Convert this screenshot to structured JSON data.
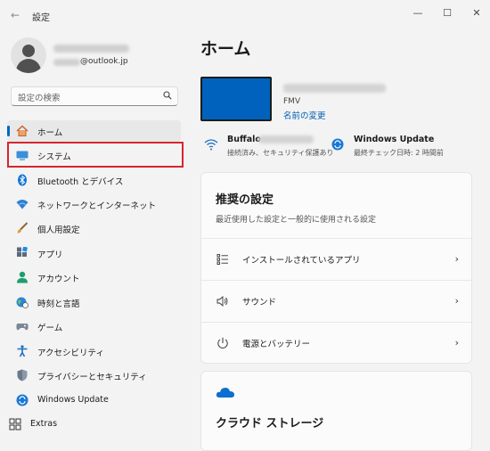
{
  "window": {
    "title": "設定",
    "back": "←",
    "minimize": "—",
    "maximize": "☐",
    "close": "✕"
  },
  "user": {
    "email_domain": "@outlook.jp"
  },
  "search": {
    "placeholder": "設定の検索"
  },
  "sidebar": {
    "items": [
      {
        "label": "ホーム",
        "icon": "home-icon"
      },
      {
        "label": "システム",
        "icon": "system-icon"
      },
      {
        "label": "Bluetooth とデバイス",
        "icon": "bluetooth-icon"
      },
      {
        "label": "ネットワークとインターネット",
        "icon": "network-icon"
      },
      {
        "label": "個人用設定",
        "icon": "brush-icon"
      },
      {
        "label": "アプリ",
        "icon": "apps-icon"
      },
      {
        "label": "アカウント",
        "icon": "account-icon"
      },
      {
        "label": "時刻と言語",
        "icon": "globe-icon"
      },
      {
        "label": "ゲーム",
        "icon": "game-icon"
      },
      {
        "label": "アクセシビリティ",
        "icon": "accessibility-icon"
      },
      {
        "label": "プライバシーとセキュリティ",
        "icon": "shield-icon"
      },
      {
        "label": "Windows Update",
        "icon": "windows-update-icon"
      },
      {
        "label": "Extras",
        "icon": "extras-icon"
      }
    ]
  },
  "main": {
    "title": "ホーム",
    "device": {
      "model": "FMV",
      "rename": "名前の変更"
    },
    "wifi": {
      "name": "Buffalo-",
      "status": "接続済み、セキュリティ保護あり"
    },
    "update": {
      "title": "Windows Update",
      "status": "最終チェック日時: 2 時間前"
    },
    "recommended": {
      "title": "推奨の設定",
      "subtitle": "最近使用した設定と一般的に使用される設定",
      "rows": [
        {
          "label": "インストールされているアプリ",
          "icon": "installed-apps-icon"
        },
        {
          "label": "サウンド",
          "icon": "speaker-icon"
        },
        {
          "label": "電源とバッテリー",
          "icon": "power-icon"
        }
      ],
      "chevron": "›"
    },
    "cloud": {
      "title": "クラウド ストレージ"
    }
  },
  "colors": {
    "accent": "#0067c0",
    "highlight_box": "#d7262c",
    "device_screen": "#0162bd"
  }
}
